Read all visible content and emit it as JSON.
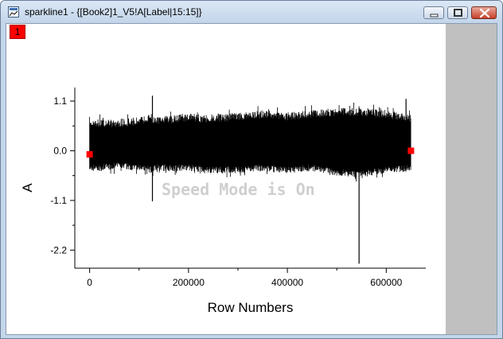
{
  "window": {
    "title": "sparkline1 - {[Book2]1_V5!A[Label|15:15]}"
  },
  "layer_tab": {
    "label": "1"
  },
  "overlay": {
    "speed_mode": "Speed Mode is On"
  },
  "icons": {
    "app": "graph-window-icon",
    "minimize": "minimize-icon",
    "maximize": "maximize-icon",
    "close": "close-icon"
  },
  "colors": {
    "data_marker": "#ff0000",
    "series": "#000000",
    "titlebar": "#c4d6ea",
    "close_button": "#c7402a"
  },
  "chart_data": {
    "type": "line",
    "title": "",
    "xlabel": "Row Numbers",
    "ylabel": "A",
    "xlim": [
      -30000,
      680000
    ],
    "ylim": [
      -2.6,
      1.4
    ],
    "x_ticks": [
      0,
      200000,
      400000,
      600000
    ],
    "x_tick_labels": [
      "0",
      "200000",
      "400000",
      "600000"
    ],
    "y_ticks": [
      1.1,
      0.0,
      -1.1,
      -2.2
    ],
    "y_tick_labels": [
      "1.1",
      "0.0",
      "-1.1",
      "-2.2"
    ],
    "grid": false,
    "legend": "none",
    "series": [
      {
        "x_range": [
          0,
          650000
        ],
        "x": [
          0,
          20000,
          60000,
          100000,
          127000,
          131000,
          160000,
          200000,
          250000,
          300000,
          350000,
          400000,
          450000,
          500000,
          545000,
          600000,
          650000
        ],
        "upper": [
          0.75,
          0.7,
          0.7,
          0.75,
          0.82,
          0.75,
          0.78,
          0.82,
          0.8,
          0.85,
          0.9,
          0.85,
          0.9,
          0.95,
          0.95,
          0.9,
          0.8
        ],
        "lower": [
          -0.45,
          -0.45,
          -0.4,
          -0.45,
          -0.5,
          -0.45,
          -0.45,
          -0.45,
          -0.5,
          -0.5,
          -0.45,
          -0.5,
          -0.45,
          -0.55,
          -0.6,
          -0.5,
          -0.45
        ],
        "spikes": [
          {
            "x": 127000,
            "low": -1.12,
            "high": 1.22
          },
          {
            "x": 545000,
            "low": -2.5,
            "high": 0.95
          },
          {
            "x": 640000,
            "low": -0.4,
            "high": 1.15
          }
        ]
      }
    ],
    "markers": [
      {
        "x": 0,
        "y": -0.08
      },
      {
        "x": 650000,
        "y": 0.0
      }
    ]
  }
}
